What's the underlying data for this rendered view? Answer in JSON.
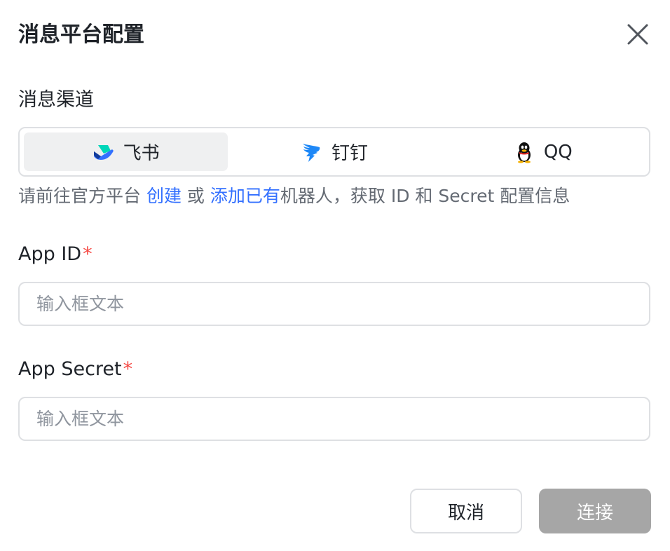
{
  "dialog": {
    "title": "消息平台配置",
    "close_icon": "close-icon"
  },
  "channel": {
    "label": "消息渠道",
    "selected": "飞书",
    "options": [
      {
        "label": "飞书",
        "icon": "feishu-icon"
      },
      {
        "label": "钉钉",
        "icon": "dingtalk-icon"
      },
      {
        "label": "QQ",
        "icon": "qq-icon"
      }
    ]
  },
  "hint": {
    "prefix": "请前往官方平台 ",
    "link_create": "创建",
    "middle": " 或 ",
    "link_add_existing": "添加已有",
    "suffix": "机器人，获取 ID 和 Secret 配置信息"
  },
  "app_id": {
    "label": "App ID",
    "required_mark": "*",
    "value": "",
    "placeholder": "输入框文本"
  },
  "app_secret": {
    "label": "App Secret",
    "required_mark": "*",
    "value": "",
    "placeholder": "输入框文本"
  },
  "actions": {
    "cancel_label": "取消",
    "connect_label": "连接"
  },
  "colors": {
    "link": "#3370ff",
    "required": "#f54a45",
    "connect_disabled_bg": "#a6a6a6",
    "segment_active_bg": "#eff0f1"
  }
}
